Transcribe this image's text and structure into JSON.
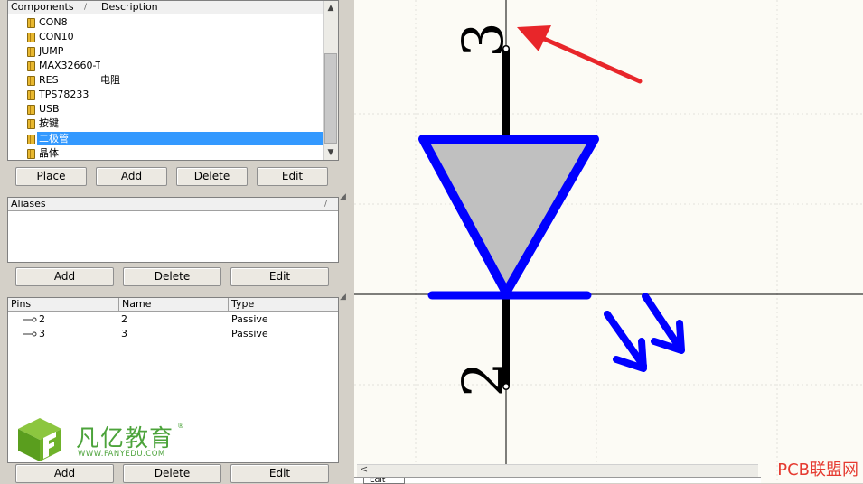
{
  "components": {
    "header_components": "Components",
    "header_description": "Description",
    "sort_mark": "/",
    "items": [
      {
        "name": "CON8",
        "desc": ""
      },
      {
        "name": "CON10",
        "desc": ""
      },
      {
        "name": "JUMP",
        "desc": ""
      },
      {
        "name": "MAX32660-T(",
        "desc": ""
      },
      {
        "name": "RES",
        "desc": "电阻"
      },
      {
        "name": "TPS78233",
        "desc": ""
      },
      {
        "name": "USB",
        "desc": ""
      },
      {
        "name": "按键",
        "desc": ""
      },
      {
        "name": "二极管",
        "desc": "",
        "selected": true
      },
      {
        "name": "晶体",
        "desc": ""
      }
    ],
    "buttons": {
      "place": "Place",
      "add": "Add",
      "delete": "Delete",
      "edit": "Edit"
    }
  },
  "aliases": {
    "header": "Aliases",
    "sort_mark": "/",
    "buttons": {
      "add": "Add",
      "delete": "Delete",
      "edit": "Edit"
    }
  },
  "pins": {
    "header_pins": "Pins",
    "header_name": "Name",
    "header_type": "Type",
    "rows": [
      {
        "pin": "2",
        "name": "2",
        "type": "Passive"
      },
      {
        "pin": "3",
        "name": "3",
        "type": "Passive"
      }
    ],
    "buttons": {
      "add": "Add",
      "delete": "Delete",
      "edit": "Edit"
    }
  },
  "logo": {
    "brand": "凡亿教育",
    "registered": "®",
    "url": "WWW.FANYEDU.COM"
  },
  "canvas": {
    "pin_top_label": "3",
    "pin_bottom_label": "2",
    "diode_outline_color": "#0000ff",
    "diode_fill_color": "#c0c0c0",
    "pin_color": "#000000",
    "annotation_arrow_color": "#e8262a"
  },
  "bottom": {
    "tab_label": "Edit",
    "scroll_left": "<"
  },
  "watermark": "PCB联盟网"
}
